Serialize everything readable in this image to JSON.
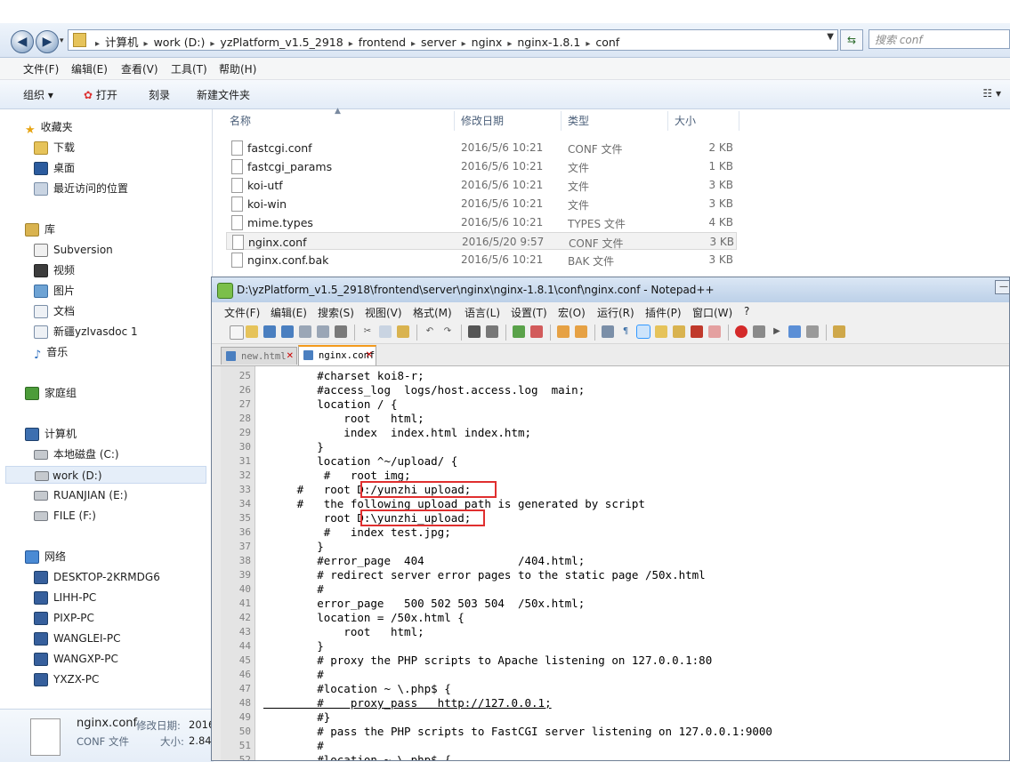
{
  "explorer": {
    "breadcrumbs": [
      "计算机",
      "work (D:)",
      "yzPlatform_v1.5_2918",
      "frontend",
      "server",
      "nginx",
      "nginx-1.8.1",
      "conf"
    ],
    "search_placeholder": "搜索 conf",
    "menu": [
      "文件(F)",
      "编辑(E)",
      "查看(V)",
      "工具(T)",
      "帮助(H)"
    ],
    "commands": {
      "organize": "组织 ▾",
      "open": "打开",
      "burn": "刻录",
      "new_folder": "新建文件夹"
    },
    "columns": {
      "name": "名称",
      "date": "修改日期",
      "type": "类型",
      "size": "大小"
    },
    "sidebar": {
      "favorites": "收藏夹",
      "favorites_items": [
        "下载",
        "桌面",
        "最近访问的位置"
      ],
      "libraries": "库",
      "library_items": [
        "Subversion",
        "视频",
        "图片",
        "文档",
        "新疆yzIvasdoc 1",
        "音乐"
      ],
      "homegroup": "家庭组",
      "computer": "计算机",
      "drives": [
        "本地磁盘 (C:)",
        "work (D:)",
        "RUANJIAN (E:)",
        "FILE (F:)"
      ],
      "network": "网络",
      "network_items": [
        "DESKTOP-2KRMDG6",
        "LIHH-PC",
        "PIXP-PC",
        "WANGLEI-PC",
        "WANGXP-PC",
        "YXZX-PC"
      ]
    },
    "files": [
      {
        "name": "fastcgi.conf",
        "date": "2016/5/6 10:21",
        "type": "CONF 文件",
        "size": "2 KB"
      },
      {
        "name": "fastcgi_params",
        "date": "2016/5/6 10:21",
        "type": "文件",
        "size": "1 KB"
      },
      {
        "name": "koi-utf",
        "date": "2016/5/6 10:21",
        "type": "文件",
        "size": "3 KB"
      },
      {
        "name": "koi-win",
        "date": "2016/5/6 10:21",
        "type": "文件",
        "size": "3 KB"
      },
      {
        "name": "mime.types",
        "date": "2016/5/6 10:21",
        "type": "TYPES 文件",
        "size": "4 KB"
      },
      {
        "name": "nginx.conf",
        "date": "2016/5/20 9:57",
        "type": "CONF 文件",
        "size": "3 KB"
      },
      {
        "name": "nginx.conf.bak",
        "date": "2016/5/6 10:21",
        "type": "BAK 文件",
        "size": "3 KB"
      }
    ],
    "details": {
      "name": "nginx.conf",
      "modified_label": "修改日期:",
      "modified_value": "2016",
      "type": "CONF 文件",
      "size_label": "大小:",
      "size_value": "2.84"
    }
  },
  "notepad": {
    "title": "D:\\yzPlatform_v1.5_2918\\frontend\\server\\nginx\\nginx-1.8.1\\conf\\nginx.conf - Notepad++",
    "menu": [
      "文件(F)",
      "编辑(E)",
      "搜索(S)",
      "视图(V)",
      "格式(M)",
      "语言(L)",
      "设置(T)",
      "宏(O)",
      "运行(R)",
      "插件(P)",
      "窗口(W)",
      "?"
    ],
    "tabs": [
      "new.html",
      "nginx.conf"
    ],
    "lines": [
      {
        "n": "25",
        "t": "        #charset koi8-r;"
      },
      {
        "n": "26",
        "t": "        #access_log  logs/host.access.log  main;"
      },
      {
        "n": "27",
        "t": "        location / {"
      },
      {
        "n": "28",
        "t": "            root   html;"
      },
      {
        "n": "29",
        "t": "            index  index.html index.htm;"
      },
      {
        "n": "30",
        "t": "        }"
      },
      {
        "n": "31",
        "t": "        location ^~/upload/ {"
      },
      {
        "n": "32",
        "t": "         #   root img;"
      },
      {
        "n": "33",
        "t": "     #   root D:/yunzhi upload;"
      },
      {
        "n": "34",
        "t": "     #   the following upload path is generated by script"
      },
      {
        "n": "35",
        "t": "         root D:\\yunzhi_upload;"
      },
      {
        "n": "36",
        "t": "         #   index test.jpg;"
      },
      {
        "n": "37",
        "t": "        }"
      },
      {
        "n": "38",
        "t": "        #error_page  404              /404.html;"
      },
      {
        "n": "39",
        "t": "        # redirect server error pages to the static page /50x.html"
      },
      {
        "n": "40",
        "t": "        #"
      },
      {
        "n": "41",
        "t": "        error_page   500 502 503 504  /50x.html;"
      },
      {
        "n": "42",
        "t": "        location = /50x.html {"
      },
      {
        "n": "43",
        "t": "            root   html;"
      },
      {
        "n": "44",
        "t": "        }"
      },
      {
        "n": "45",
        "t": "        # proxy the PHP scripts to Apache listening on 127.0.0.1:80"
      },
      {
        "n": "46",
        "t": "        #"
      },
      {
        "n": "47",
        "t": "        #location ~ \\.php$ {"
      },
      {
        "n": "48",
        "t": "        #    proxy_pass   http://127.0.0.1;"
      },
      {
        "n": "49",
        "t": "        #}"
      },
      {
        "n": "50",
        "t": "        # pass the PHP scripts to FastCGI server listening on 127.0.0.1:9000"
      },
      {
        "n": "51",
        "t": "        #"
      },
      {
        "n": "52",
        "t": "        #location ~ \\.php$ {"
      }
    ]
  },
  "colors": {
    "highlight_box": "#e02f2f",
    "tab_accent": "#f39a1d",
    "selection": "#e5eef9"
  }
}
